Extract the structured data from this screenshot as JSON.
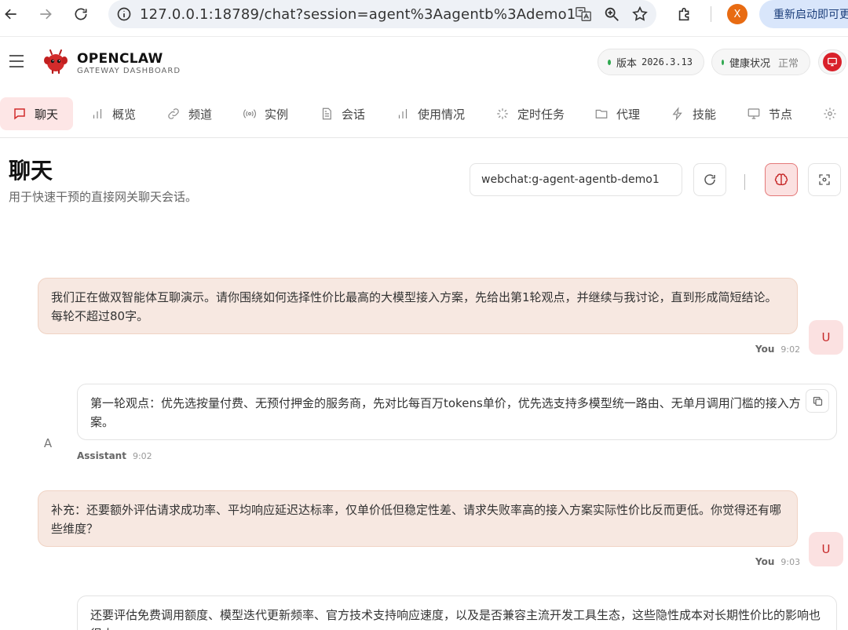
{
  "browser": {
    "url": "127.0.0.1:18789/chat?session=agent%3Aagentb%3Ademo1",
    "profile_initial": "X",
    "restart_label": "重新启动即可更新"
  },
  "header": {
    "brand_title": "OPENCLAW",
    "brand_subtitle": "GATEWAY DASHBOARD",
    "version_label": "版本",
    "version_value": "2026.3.13",
    "health_label": "健康状况",
    "health_value": "正常",
    "status_color": "#2fa84f",
    "accent_color": "#d9202a"
  },
  "tabs": [
    {
      "label": "聊天",
      "icon": "chat-bubble-icon",
      "active": true
    },
    {
      "label": "概览",
      "icon": "bar-chart-icon"
    },
    {
      "label": "频道",
      "icon": "link-icon"
    },
    {
      "label": "实例",
      "icon": "broadcast-icon"
    },
    {
      "label": "会话",
      "icon": "document-icon"
    },
    {
      "label": "使用情况",
      "icon": "bar-chart-icon"
    },
    {
      "label": "定时任务",
      "icon": "loader-icon"
    },
    {
      "label": "代理",
      "icon": "folder-icon"
    },
    {
      "label": "技能",
      "icon": "lightning-icon"
    },
    {
      "label": "节点",
      "icon": "monitor-icon"
    },
    {
      "label": "",
      "icon": "gear-icon"
    }
  ],
  "page": {
    "title": "聊天",
    "subtitle": "用于快速干预的直接网关聊天会话。",
    "session_value": "webchat:g-agent-agentb-demo1"
  },
  "messages": [
    {
      "role": "user",
      "text": "我们正在做双智能体互聊演示。请你围绕如何选择性价比最高的大模型接入方案，先给出第1轮观点，并继续与我讨论，直到形成简短结论。每轮不超过80字。",
      "sender": "You",
      "time": "9:02",
      "avatar": "U"
    },
    {
      "role": "assistant",
      "text": "第一轮观点：优先选按量付费、无预付押金的服务商，先对比每百万tokens单价，优先选支持多模型统一路由、无单月调用门槛的接入方案。",
      "sender": "Assistant",
      "time": "9:02",
      "avatar": "A"
    },
    {
      "role": "user",
      "text": "补充：还要额外评估请求成功率、平均响应延迟达标率，仅单价低但稳定性差、请求失败率高的接入方案实际性价比反而更低。你觉得还有哪些维度？",
      "sender": "You",
      "time": "9:03",
      "avatar": "U"
    },
    {
      "role": "assistant",
      "text": "还要评估免费调用额度、模型迭代更新频率、官方技术支持响应速度，以及是否兼容主流开发工具生态，这些隐性成本对长期性价比的影响也很大。"
    }
  ]
}
